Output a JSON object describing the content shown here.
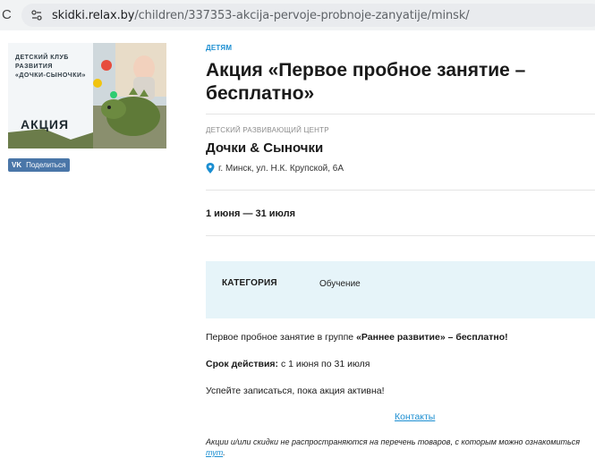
{
  "browser": {
    "url_host": "skidki.relax.by",
    "url_path": "/children/337353-akcija-pervoje-probnoje-zanyatije/minsk/"
  },
  "promo_image": {
    "club_text_line1": "ДЕТСКИЙ КЛУБ",
    "club_text_line2": "РАЗВИТИЯ",
    "club_text_line3": "«ДОЧКИ-СЫНОЧКИ»",
    "badge": "АКЦИЯ"
  },
  "share": {
    "logo": "VK",
    "label": "Поделиться"
  },
  "promo": {
    "category_tag": "ДЕТЯМ",
    "title": "Акция «Первое пробное занятие – бесплатно»",
    "org_type": "ДЕТСКИЙ РАЗВИВАЮЩИЙ ЦЕНТР",
    "org_name": "Дочки & Сыночки",
    "address": "г. Минск, ул. Н.К. Крупской, 6А",
    "dates": "1 июня — 31 июля"
  },
  "info": {
    "label": "КАТЕГОРИЯ",
    "value": "Обучение"
  },
  "description": {
    "line1_prefix": "Первое пробное занятие в группе ",
    "line1_bold": "«Раннее развитие» – бесплатно!",
    "validity_label": "Срок действия:",
    "validity_value": " с 1 июня по 31 июля",
    "line3": "Успейте записаться, пока акция активна!",
    "contacts_link": "Контакты"
  },
  "disclaimer": {
    "text": "Акции и/или скидки не распространяются на перечень товаров, с которым можно ознакомиться ",
    "link": "тут",
    "suffix": "."
  },
  "colors": {
    "accent": "#1b8ed1",
    "vk": "#4a76a8",
    "info_bg": "#e6f4f9"
  }
}
